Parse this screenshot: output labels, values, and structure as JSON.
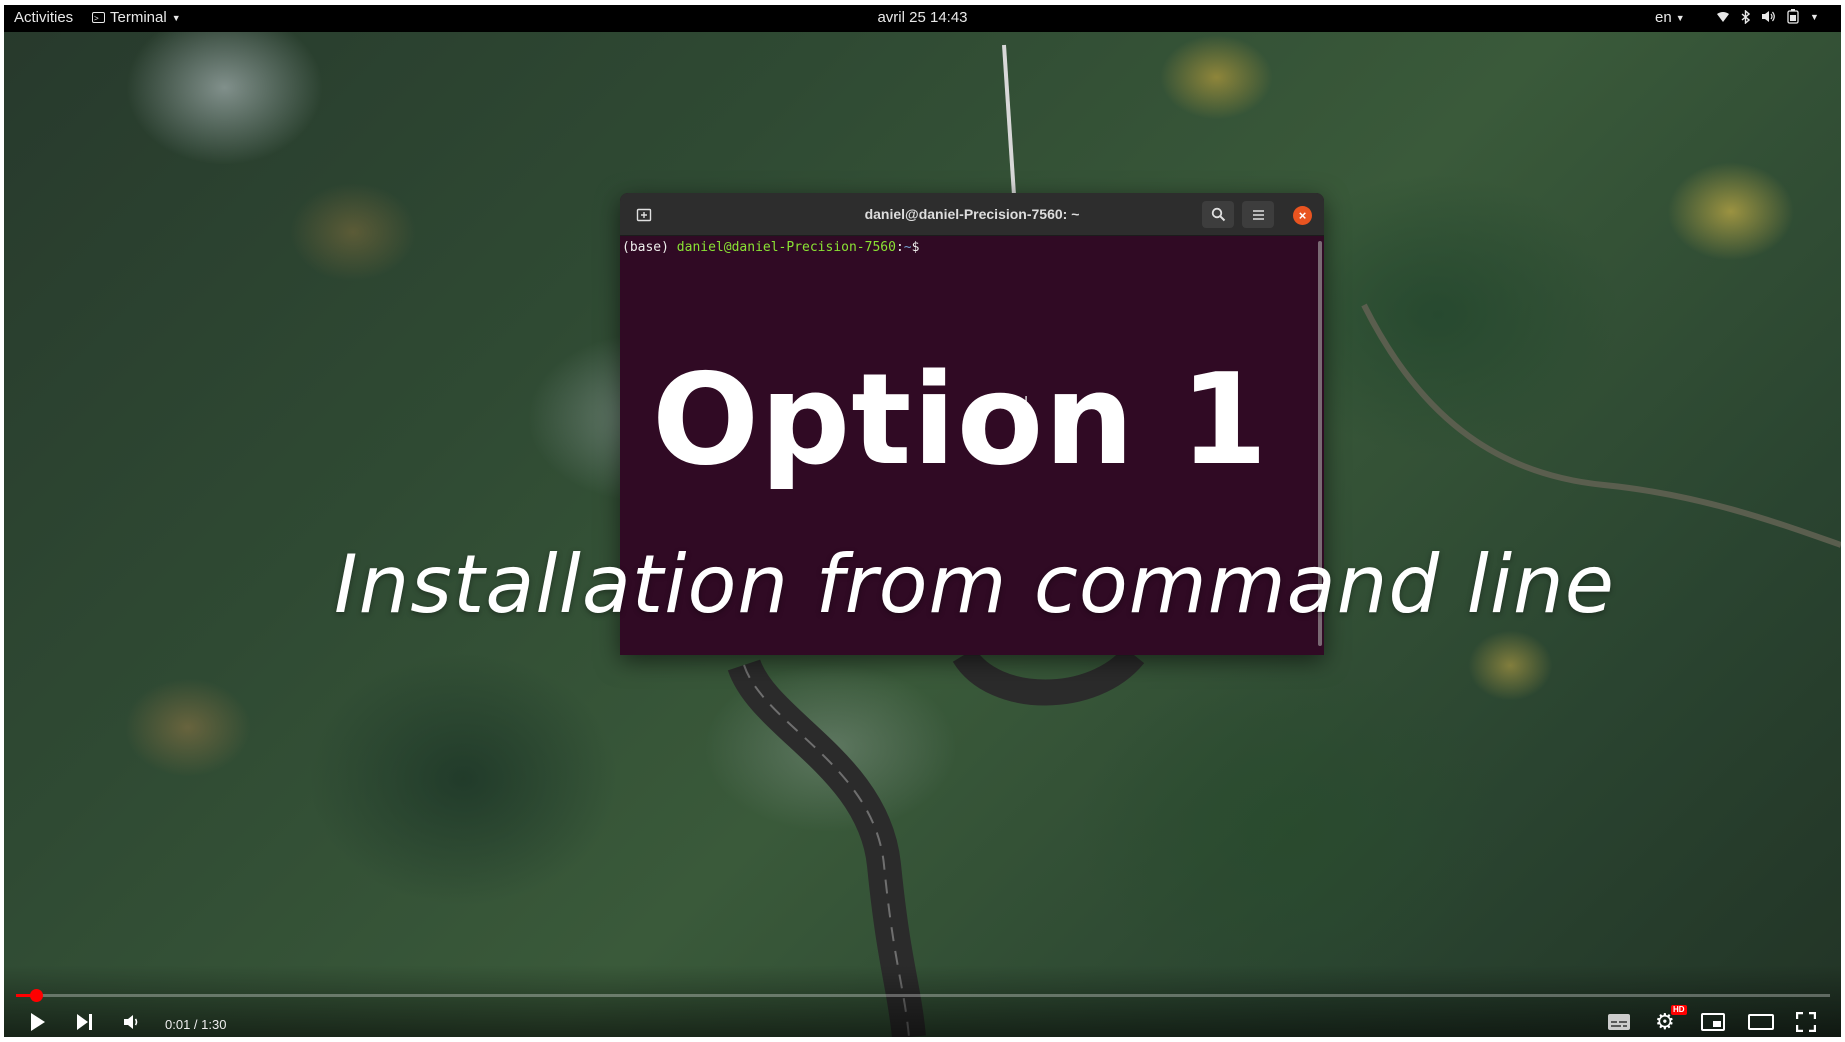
{
  "topbar": {
    "activities": "Activities",
    "app_menu": "Terminal",
    "clock": "avril 25  14:43",
    "language": "en"
  },
  "terminal": {
    "title": "daniel@daniel-Precision-7560: ~",
    "prompt_env": "(base)",
    "prompt_user": "daniel@daniel-Precision-7560",
    "prompt_sep": ":",
    "prompt_path": "~",
    "prompt_symbol": "$"
  },
  "overlay": {
    "title": "Option 1",
    "subtitle": "Installation from command line"
  },
  "player": {
    "time": "0:01 / 1:30",
    "progress_fraction": 0.011,
    "hd_badge": "HD",
    "accent_color": "#ff0000"
  },
  "icons": {
    "terminal_bg": "#300a24",
    "close_button": "#e95420"
  }
}
